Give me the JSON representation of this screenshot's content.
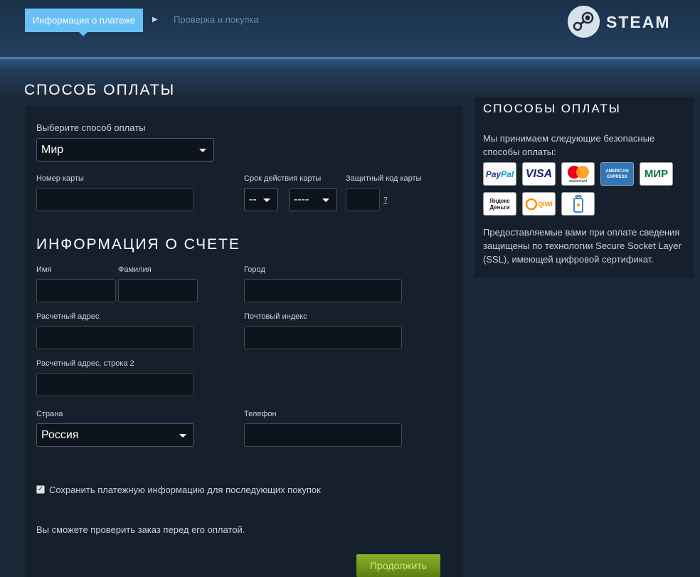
{
  "steps": {
    "active": "Информация о платеже",
    "next": "Проверка и покупка"
  },
  "logo": {
    "text": "STEAM"
  },
  "payment": {
    "title": "СПОСОБ ОПЛАТЫ",
    "method_label": "Выберите способ оплаты",
    "method_value": "Мир",
    "card_number_label": "Номер карты",
    "expiry_label": "Срок действия карты",
    "expiry_month": "--",
    "expiry_year": "----",
    "cvv_label": "Защитный код карты",
    "cvv_help": "?"
  },
  "billing": {
    "title": "ИНФОРМАЦИЯ О СЧЕТЕ",
    "first_name_label": "Имя",
    "last_name_label": "Фамилия",
    "city_label": "Город",
    "address_label": "Расчетный адрес",
    "zip_label": "Почтовый индекс",
    "address2_label": "Расчетный адрес, строка 2",
    "country_label": "Страна",
    "country_value": "Россия",
    "phone_label": "Телефон",
    "save_label": "Сохранить платежную информацию для последующих покупок",
    "review_note": "Вы сможете проверить заказ перед его оплатой.",
    "continue_label": "Продолжить"
  },
  "sidebar": {
    "title": "СПОСОБЫ ОПЛАТЫ",
    "intro": "Мы принимаем следующие безопасные способы оплаты:",
    "methods": [
      {
        "name": "PayPal",
        "icon": "paypal-logo"
      },
      {
        "name": "VISA",
        "icon": "visa-logo"
      },
      {
        "name": "mastercard",
        "icon": "mastercard-logo"
      },
      {
        "name": "AMERICAN EXPRESS",
        "icon": "amex-logo"
      },
      {
        "name": "МИР",
        "icon": "mir-logo"
      },
      {
        "name": "Яндекс Деньги",
        "icon": "yandex-money-logo"
      },
      {
        "name": "QIWI",
        "icon": "qiwi-logo"
      },
      {
        "name": "",
        "icon": "mobile-payment-logo"
      }
    ],
    "ssl_note": "Предоставляемые вами при оплате сведения защищены по технологии Secure Socket Layer (SSL), имеющей цифровой сертификат."
  },
  "colors": {
    "background": "#1b2838",
    "accent": "#67c1f5",
    "button": "#75a01e"
  }
}
